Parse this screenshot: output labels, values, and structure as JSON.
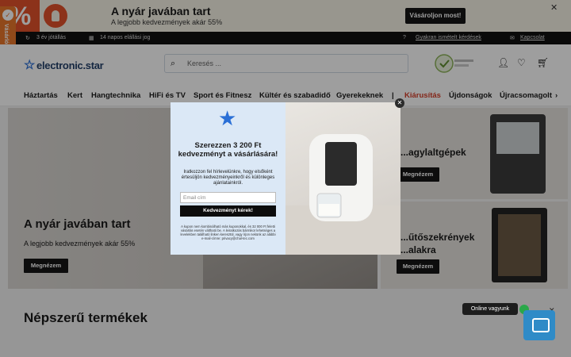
{
  "promo": {
    "percent_glyph": "%",
    "title": "A nyár javában tart",
    "subtitle": "A legjobb kedvezmények akár 55%",
    "button": "Vásároljon most!",
    "close": "✕"
  },
  "side_tab": {
    "label": "Vásárlói vélemények",
    "icon": "✓"
  },
  "topbar": {
    "warranty": "3 év jótállás",
    "returns": "14 napos elállási jog",
    "faq": "Gyakran ismételt kérdések",
    "contact": "Kapcsolat"
  },
  "header": {
    "logo": "electronic.star",
    "logo_icon": "star-icon",
    "search_placeholder": "Keresés ..."
  },
  "nav": [
    "Háztartás",
    "Kert",
    "Hangtechnika",
    "HiFi és TV",
    "Sport és Fitnesz",
    "Kültér és szabadidő",
    "Gyerekeknek",
    "|",
    "Kiárusítás",
    "Újdonságok",
    "Újracsomagolt"
  ],
  "nav_sale_color": "#d6402b",
  "hero": {
    "title": "A nyár javában tart",
    "subtitle": "A legjobb kedvezmények akár 55%",
    "button": "Megnézem"
  },
  "cards": [
    {
      "title": "...agylaltgépek",
      "button": "Megnézem"
    },
    {
      "title": "...űtőszekrények",
      "title2": "...alakra",
      "button": "Megnézem"
    }
  ],
  "popular": {
    "title": "Népszerű termékek"
  },
  "chat": {
    "online": "Online vagyunk",
    "close": "✕"
  },
  "modal": {
    "title": "Szerezzen 3 200 Ft kedvezményt a vásárlására!",
    "text": "Iratkozzon fel hírlevelünkre, hogy elsőként értesüljön kedvezményeinkről és különleges ajánlatainkról.",
    "email_placeholder": "Email cím",
    "submit": "Kedvezményt kérek!",
    "fine_print": "A kupon nem kombinálható más kuponokkal, és 32 000 Ft feletti vásárlás esetén váltható be. A leiratkozás bármikor lehetséges a levelekben található linken keresztül, vagy írjon nekünk az alábbi e-mail-címre: privacy@chal-tec.com",
    "close": "✕"
  },
  "colors": {
    "accent": "#2a6fd6",
    "promo": "#e3522a",
    "side_tab": "#e9762b",
    "chat": "#2f8bc7",
    "online_dot": "#2aa84a"
  }
}
